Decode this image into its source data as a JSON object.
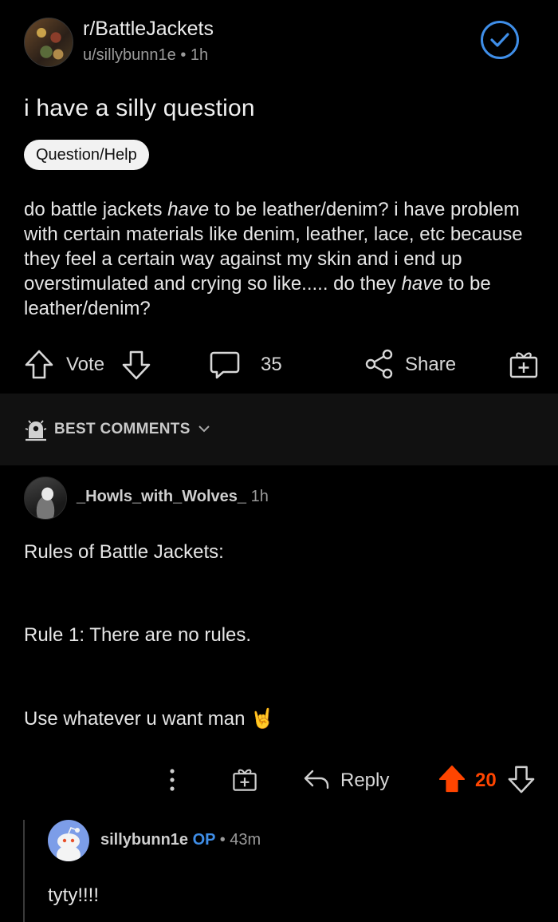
{
  "post": {
    "subreddit": "r/BattleJackets",
    "author": "u/sillybunn1e",
    "separator": "•",
    "age": "1h",
    "title": "i have a silly question",
    "flair": "Question/Help",
    "body": {
      "part1": "do battle jackets ",
      "em1": "have",
      "part2": " to be leather/denim? i have problem with certain materials like denim, leather, lace, etc because they feel a certain way against my skin and i end up overstimulated and crying so like..... do they ",
      "em2": "have",
      "part3": " to be leather/denim?"
    },
    "actions": {
      "vote_label": "Vote",
      "comment_count": "35",
      "share_label": "Share"
    }
  },
  "sort": {
    "label": "BEST COMMENTS"
  },
  "comments": [
    {
      "user": "_Howls_with_Wolves_",
      "age": "1h",
      "lines": [
        "Rules of Battle Jackets:",
        "Rule 1: There are no rules.",
        "Use whatever u want man"
      ],
      "emoji": "🤘",
      "actions": {
        "reply_label": "Reply",
        "score": "20"
      }
    },
    {
      "user": "sillybunn1e",
      "op_badge": "OP",
      "separator": "•",
      "age": "43m",
      "text": "tyty!!!!"
    }
  ],
  "colors": {
    "accent_blue": "#3f8ee8",
    "upvote_orange": "#ff4500",
    "background": "#000000",
    "sort_bar": "#111111"
  },
  "icons": [
    "check-circle-icon",
    "upvote-icon",
    "downvote-icon",
    "comment-icon",
    "share-icon",
    "award-icon",
    "sort-icon",
    "chevron-down-icon",
    "more-icon",
    "reply-icon"
  ]
}
